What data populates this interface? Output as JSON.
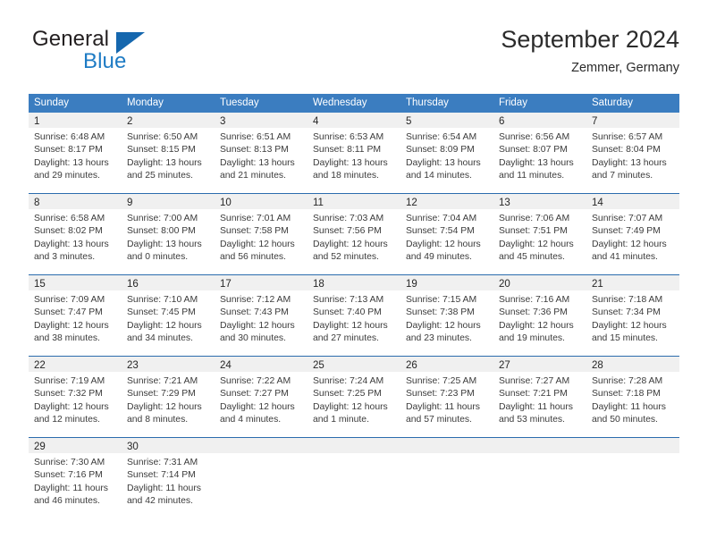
{
  "logo": {
    "word1": "General",
    "word2": "Blue",
    "triangle_color": "#1567ae",
    "blue_text_color": "#1e7bc4",
    "dark_text_color": "#231f20",
    "icon": "triangle-logo-mark"
  },
  "header": {
    "title": "September 2024",
    "subtitle": "Zemmer, Germany"
  },
  "theme": {
    "header_blue": "#3b7dc0",
    "row_rule_blue": "#2b6cad",
    "day_band_gray": "#f0f0f0"
  },
  "weekdays": [
    "Sunday",
    "Monday",
    "Tuesday",
    "Wednesday",
    "Thursday",
    "Friday",
    "Saturday"
  ],
  "weeks": [
    [
      {
        "day": "1",
        "lines": [
          "Sunrise: 6:48 AM",
          "Sunset: 8:17 PM",
          "Daylight: 13 hours",
          "and 29 minutes."
        ]
      },
      {
        "day": "2",
        "lines": [
          "Sunrise: 6:50 AM",
          "Sunset: 8:15 PM",
          "Daylight: 13 hours",
          "and 25 minutes."
        ]
      },
      {
        "day": "3",
        "lines": [
          "Sunrise: 6:51 AM",
          "Sunset: 8:13 PM",
          "Daylight: 13 hours",
          "and 21 minutes."
        ]
      },
      {
        "day": "4",
        "lines": [
          "Sunrise: 6:53 AM",
          "Sunset: 8:11 PM",
          "Daylight: 13 hours",
          "and 18 minutes."
        ]
      },
      {
        "day": "5",
        "lines": [
          "Sunrise: 6:54 AM",
          "Sunset: 8:09 PM",
          "Daylight: 13 hours",
          "and 14 minutes."
        ]
      },
      {
        "day": "6",
        "lines": [
          "Sunrise: 6:56 AM",
          "Sunset: 8:07 PM",
          "Daylight: 13 hours",
          "and 11 minutes."
        ]
      },
      {
        "day": "7",
        "lines": [
          "Sunrise: 6:57 AM",
          "Sunset: 8:04 PM",
          "Daylight: 13 hours",
          "and 7 minutes."
        ]
      }
    ],
    [
      {
        "day": "8",
        "lines": [
          "Sunrise: 6:58 AM",
          "Sunset: 8:02 PM",
          "Daylight: 13 hours",
          "and 3 minutes."
        ]
      },
      {
        "day": "9",
        "lines": [
          "Sunrise: 7:00 AM",
          "Sunset: 8:00 PM",
          "Daylight: 13 hours",
          "and 0 minutes."
        ]
      },
      {
        "day": "10",
        "lines": [
          "Sunrise: 7:01 AM",
          "Sunset: 7:58 PM",
          "Daylight: 12 hours",
          "and 56 minutes."
        ]
      },
      {
        "day": "11",
        "lines": [
          "Sunrise: 7:03 AM",
          "Sunset: 7:56 PM",
          "Daylight: 12 hours",
          "and 52 minutes."
        ]
      },
      {
        "day": "12",
        "lines": [
          "Sunrise: 7:04 AM",
          "Sunset: 7:54 PM",
          "Daylight: 12 hours",
          "and 49 minutes."
        ]
      },
      {
        "day": "13",
        "lines": [
          "Sunrise: 7:06 AM",
          "Sunset: 7:51 PM",
          "Daylight: 12 hours",
          "and 45 minutes."
        ]
      },
      {
        "day": "14",
        "lines": [
          "Sunrise: 7:07 AM",
          "Sunset: 7:49 PM",
          "Daylight: 12 hours",
          "and 41 minutes."
        ]
      }
    ],
    [
      {
        "day": "15",
        "lines": [
          "Sunrise: 7:09 AM",
          "Sunset: 7:47 PM",
          "Daylight: 12 hours",
          "and 38 minutes."
        ]
      },
      {
        "day": "16",
        "lines": [
          "Sunrise: 7:10 AM",
          "Sunset: 7:45 PM",
          "Daylight: 12 hours",
          "and 34 minutes."
        ]
      },
      {
        "day": "17",
        "lines": [
          "Sunrise: 7:12 AM",
          "Sunset: 7:43 PM",
          "Daylight: 12 hours",
          "and 30 minutes."
        ]
      },
      {
        "day": "18",
        "lines": [
          "Sunrise: 7:13 AM",
          "Sunset: 7:40 PM",
          "Daylight: 12 hours",
          "and 27 minutes."
        ]
      },
      {
        "day": "19",
        "lines": [
          "Sunrise: 7:15 AM",
          "Sunset: 7:38 PM",
          "Daylight: 12 hours",
          "and 23 minutes."
        ]
      },
      {
        "day": "20",
        "lines": [
          "Sunrise: 7:16 AM",
          "Sunset: 7:36 PM",
          "Daylight: 12 hours",
          "and 19 minutes."
        ]
      },
      {
        "day": "21",
        "lines": [
          "Sunrise: 7:18 AM",
          "Sunset: 7:34 PM",
          "Daylight: 12 hours",
          "and 15 minutes."
        ]
      }
    ],
    [
      {
        "day": "22",
        "lines": [
          "Sunrise: 7:19 AM",
          "Sunset: 7:32 PM",
          "Daylight: 12 hours",
          "and 12 minutes."
        ]
      },
      {
        "day": "23",
        "lines": [
          "Sunrise: 7:21 AM",
          "Sunset: 7:29 PM",
          "Daylight: 12 hours",
          "and 8 minutes."
        ]
      },
      {
        "day": "24",
        "lines": [
          "Sunrise: 7:22 AM",
          "Sunset: 7:27 PM",
          "Daylight: 12 hours",
          "and 4 minutes."
        ]
      },
      {
        "day": "25",
        "lines": [
          "Sunrise: 7:24 AM",
          "Sunset: 7:25 PM",
          "Daylight: 12 hours",
          "and 1 minute."
        ]
      },
      {
        "day": "26",
        "lines": [
          "Sunrise: 7:25 AM",
          "Sunset: 7:23 PM",
          "Daylight: 11 hours",
          "and 57 minutes."
        ]
      },
      {
        "day": "27",
        "lines": [
          "Sunrise: 7:27 AM",
          "Sunset: 7:21 PM",
          "Daylight: 11 hours",
          "and 53 minutes."
        ]
      },
      {
        "day": "28",
        "lines": [
          "Sunrise: 7:28 AM",
          "Sunset: 7:18 PM",
          "Daylight: 11 hours",
          "and 50 minutes."
        ]
      }
    ],
    [
      {
        "day": "29",
        "lines": [
          "Sunrise: 7:30 AM",
          "Sunset: 7:16 PM",
          "Daylight: 11 hours",
          "and 46 minutes."
        ]
      },
      {
        "day": "30",
        "lines": [
          "Sunrise: 7:31 AM",
          "Sunset: 7:14 PM",
          "Daylight: 11 hours",
          "and 42 minutes."
        ]
      },
      {
        "day": "",
        "lines": []
      },
      {
        "day": "",
        "lines": []
      },
      {
        "day": "",
        "lines": []
      },
      {
        "day": "",
        "lines": []
      },
      {
        "day": "",
        "lines": []
      }
    ]
  ]
}
